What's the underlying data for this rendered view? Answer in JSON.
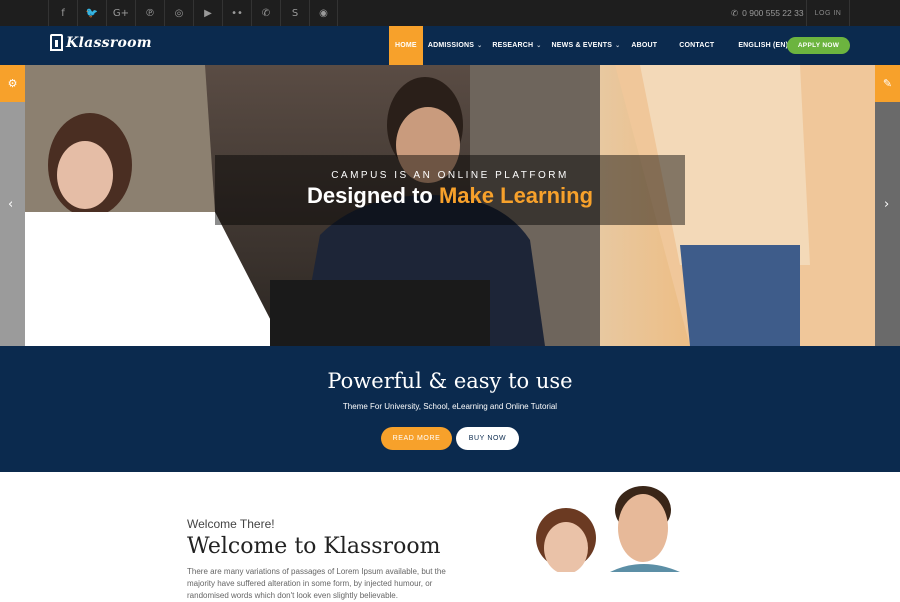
{
  "topbar": {
    "social_icons": [
      {
        "name": "facebook-icon",
        "glyph": "f"
      },
      {
        "name": "twitter-icon",
        "glyph": "🐦"
      },
      {
        "name": "google-plus-icon",
        "glyph": "G+"
      },
      {
        "name": "pinterest-icon",
        "glyph": "℗"
      },
      {
        "name": "instagram-icon",
        "glyph": "◎"
      },
      {
        "name": "youtube-icon",
        "glyph": "▶"
      },
      {
        "name": "flickr-icon",
        "glyph": "••"
      },
      {
        "name": "whatsapp-icon",
        "glyph": "✆"
      },
      {
        "name": "skype-icon",
        "glyph": "S"
      },
      {
        "name": "github-icon",
        "glyph": "◉"
      }
    ],
    "phone": "0 900 555 22 33",
    "login": "LOG IN"
  },
  "nav": {
    "logo": "Klassroom",
    "items": [
      {
        "label": "HOME",
        "active": true,
        "dropdown": false
      },
      {
        "label": "ADMISSIONS",
        "active": false,
        "dropdown": true
      },
      {
        "label": "RESEARCH",
        "active": false,
        "dropdown": true
      },
      {
        "label": "NEWS & EVENTS",
        "active": false,
        "dropdown": true
      },
      {
        "label": "ABOUT",
        "active": false,
        "dropdown": false
      },
      {
        "label": "CONTACT",
        "active": false,
        "dropdown": false
      },
      {
        "label": "ENGLISH (EN)",
        "active": false,
        "dropdown": true
      }
    ],
    "apply": "APPLY NOW"
  },
  "hero": {
    "kicker": "CAMPUS IS AN ONLINE PLATFORM",
    "headline_prefix": "Designed to",
    "headline_highlight": "Make Learning"
  },
  "band": {
    "title": "Powerful & easy to use",
    "subtitle": "Theme For University, School, eLearning and Online Tutorial",
    "read_more": "READ MORE",
    "buy_now": "BUY NOW"
  },
  "welcome": {
    "kicker": "Welcome There!",
    "title": "Welcome to Klassroom",
    "text": "There are many variations of passages of Lorem Ipsum available, but the majority have suffered alteration in some form, by injected humour, or randomised words which don't look even slightly believable."
  },
  "colors": {
    "accent": "#f7a12b",
    "navy": "#0b2a4e",
    "green": "#6cb43f"
  }
}
